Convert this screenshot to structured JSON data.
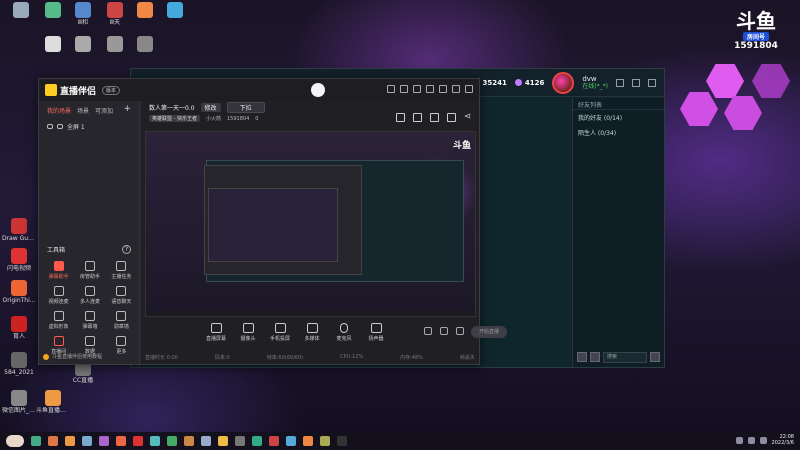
{
  "desktop": {
    "icons": [
      {
        "label": "",
        "color": "#9ab"
      },
      {
        "label": "",
        "color": "#5b8"
      },
      {
        "label": "Ⅲ和",
        "color": "#58c"
      },
      {
        "label": "Ⅲ天",
        "color": "#c44"
      },
      {
        "label": "",
        "color": "#e84"
      },
      {
        "label": "",
        "color": "#4ad"
      },
      {
        "label": "",
        "color": "#ddd"
      },
      {
        "label": "",
        "color": "#aaa"
      },
      {
        "label": "",
        "color": "#999"
      },
      {
        "label": "",
        "color": "#888"
      },
      {
        "label": "Draw Guess",
        "color": "#c33"
      },
      {
        "label": "闪电视频",
        "color": "#d33"
      },
      {
        "label": "OriginThi...",
        "color": "#e63"
      },
      {
        "label": "育人",
        "color": "#c22"
      },
      {
        "label": "584_2021",
        "color": "#666"
      },
      {
        "label": "CC直播",
        "color": "#777"
      },
      {
        "label": "微信图片_2021101...",
        "color": "#888"
      },
      {
        "label": "斗鱼直播伴侣",
        "color": "#e94"
      }
    ]
  },
  "brand": {
    "logo": "斗鱼",
    "tag": "房间号",
    "number": "1591804"
  },
  "live_window": {
    "coins": "35241",
    "diamonds": "4126",
    "user": {
      "name": "dvw",
      "status": "在线(*_*)"
    },
    "friends": {
      "header": "好友列表",
      "rows": [
        "我的好友 (0/14)",
        "陌生人 (0/34)"
      ],
      "search_placeholder": "搜索"
    }
  },
  "app": {
    "logo": "直播伴侣",
    "version": "版本",
    "side_tabs": [
      "我的场景",
      "场景",
      "可添加"
    ],
    "scene_name": "全屏 1",
    "tools_title": "工具箱",
    "tools": [
      {
        "label": "弹幕助手",
        "hot": true
      },
      {
        "label": "房管助手",
        "hot": false
      },
      {
        "label": "主播任务",
        "hot": false
      },
      {
        "label": "视频连麦",
        "hot": false
      },
      {
        "label": "多人连麦",
        "hot": false
      },
      {
        "label": "语音聊天",
        "hot": false
      },
      {
        "label": "虚拟形象",
        "hot": false
      },
      {
        "label": "弹幕墙",
        "hot": false
      },
      {
        "label": "勋章墙",
        "hot": false
      },
      {
        "label": "直播间",
        "hot2": true
      },
      {
        "label": "数据",
        "hot": false
      },
      {
        "label": "更多",
        "hot": false
      }
    ],
    "footer_note": "斗鱼直播伴侣使用教程",
    "room_title": "数人第一天一0.0",
    "edit_label": "修改",
    "category": "下拉",
    "room_tag": "英雄联盟 - 快乐王者",
    "room_small": "小火箭",
    "room_id": "1591804",
    "room_count": "0",
    "controls": [
      "直播屏幕",
      "摄像头",
      "手机投屏",
      "多媒体",
      "麦克风",
      "扬声器"
    ],
    "start_label": "开始直播",
    "status": [
      "直播时长 0:00",
      "码率:0",
      "帧率:60(60/60)",
      "CPU:12%",
      "内存:48%",
      "帧丢失"
    ]
  },
  "taskbar": {
    "apps": [
      "#e9d8c8",
      "#4a8",
      "#d74",
      "#e94",
      "#7ac",
      "#a6c",
      "#e64",
      "#d33",
      "#5bb",
      "#4a6",
      "#c84",
      "#9ac",
      "#eb4",
      "#777",
      "#3a8",
      "#c44",
      "#5ad",
      "#e84",
      "#aa5",
      "#333"
    ],
    "time": "22:08",
    "date": "2022/3/6"
  }
}
